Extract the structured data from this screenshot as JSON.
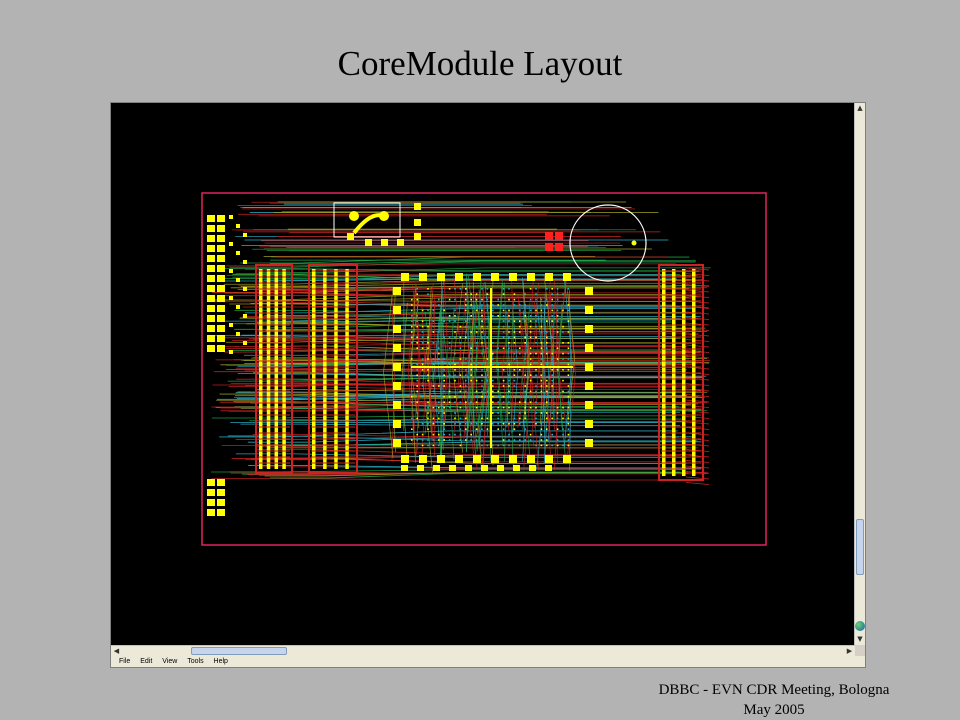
{
  "slide": {
    "title": "CoreModule Layout",
    "footer_line1": "DBBC -  EVN CDR Meeting, Bologna",
    "footer_line2": "May 2005"
  },
  "menu": {
    "items": [
      "File",
      "Edit",
      "View",
      "Tools",
      "Help"
    ]
  },
  "icons": {
    "scroll_up": "scroll-up-arrow",
    "scroll_down": "scroll-down-arrow",
    "scroll_left": "scroll-left-arrow",
    "scroll_right": "scroll-right-arrow",
    "navigator": "globe-icon"
  },
  "colors": {
    "canvas_bg": "#000000",
    "board_outline": "#e0245e",
    "pad": "#ffff00",
    "trace_red": "#cc2222",
    "trace_green": "#1fa84a",
    "trace_cyan": "#2ab0c8",
    "trace_olive": "#a0a020",
    "silkscreen": "#ffffff",
    "slide_bg": "#b3b3b3"
  }
}
